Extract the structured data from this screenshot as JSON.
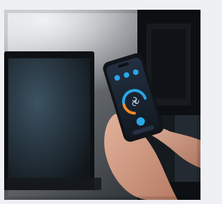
{
  "image": {
    "kind": "photo",
    "subject": "hand-holding-smartphone-with-smart-home-app",
    "palette": {
      "frame": "#eef0f4",
      "room_dark": "#1a1f24",
      "tv_frame": "#0e1114",
      "screen_glow": "#2a3c49",
      "phone_body": "#111418",
      "phone_screen": "#1a2230",
      "accent_blue": "#2aa7e8",
      "accent_orange": "#f08a2a",
      "skin": "#d9a68f"
    }
  },
  "phone_screen": {
    "shows_dial": true,
    "dial_level_fraction": 0.72
  }
}
